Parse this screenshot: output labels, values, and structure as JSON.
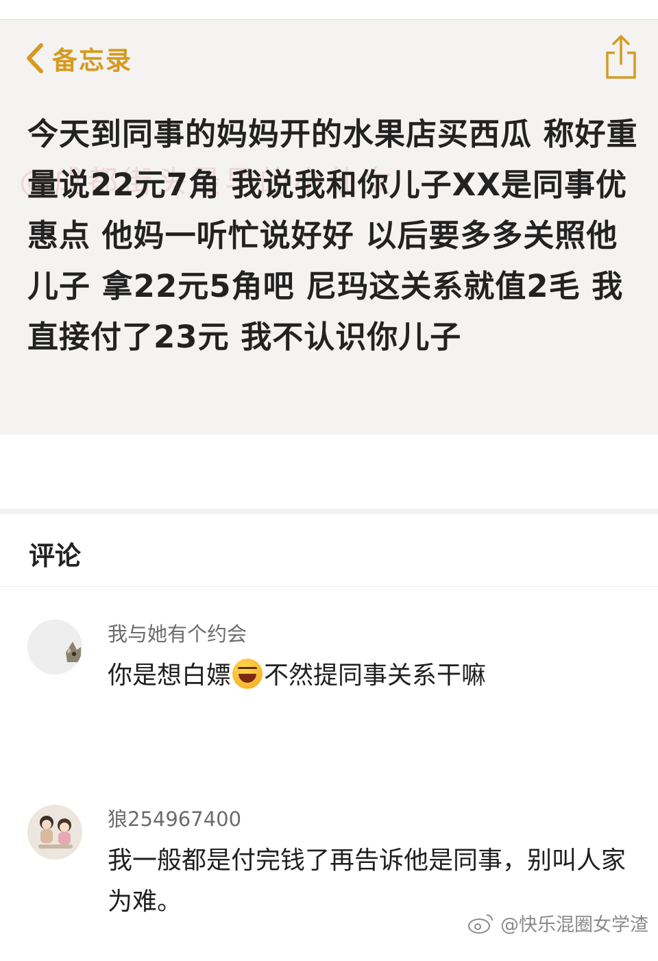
{
  "note": {
    "back_label": "备忘录",
    "watermark": "@成都街头最早的小仙女",
    "body": "今天到同事的妈妈开的水果店买西瓜  称好重量说22元7角  我说我和你儿子XX是同事优惠点   他妈一听忙说好好   以后要多多关照他儿子   拿22元5角吧   尼玛这关系就值2毛   我直接付了23元  我不认识你儿子"
  },
  "comments": {
    "title": "评论",
    "items": [
      {
        "username": "我与她有个约会",
        "text_before": "你是想白嫖",
        "emoji": "laugh-emoji",
        "text_after": "不然提同事关系干嘛"
      },
      {
        "username": "狼254967400",
        "text": "我一般都是付完钱了再告诉他是同事，别叫人家为难。"
      }
    ]
  },
  "footer": {
    "watermark": "@快乐混圈女学渣"
  },
  "colors": {
    "accent": "#d69a1e",
    "note_bg": "#f4f3f1"
  }
}
